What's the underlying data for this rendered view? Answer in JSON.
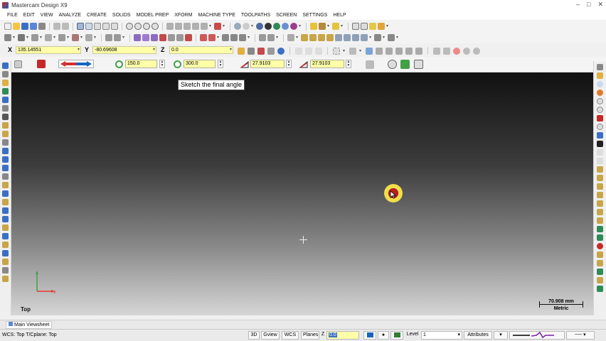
{
  "app": {
    "title": "Mastercam Design X9"
  },
  "menu": [
    "FILE",
    "EDIT",
    "VIEW",
    "ANALYZE",
    "CREATE",
    "SOLIDS",
    "MODEL PREP",
    "XFORM",
    "MACHINE TYPE",
    "TOOLPATHS",
    "SCREEN",
    "SETTINGS",
    "HELP"
  ],
  "coords": {
    "x_label": "X",
    "x_value": "135.14551",
    "y_label": "Y",
    "y_value": "-80.69608",
    "z_label": "Z",
    "z_value": "0.0"
  },
  "ribbon": {
    "field1": "150.0",
    "field2": "300.0",
    "field3": "27.9103",
    "field4": "27.9103"
  },
  "graphics": {
    "prompt": "Sketch the final angle",
    "view_name": "Top",
    "scale_value": "70.908 mm",
    "scale_unit": "Metric"
  },
  "viewsheet": {
    "tab": "Main Viewsheet"
  },
  "status": {
    "wcs_text": "WCS: Top  T/Cplane: Top",
    "btn_3d": "3D",
    "btn_gview": "Gview",
    "btn_wcs": "WCS",
    "btn_planes": "Planes",
    "z_label": "Z",
    "z_value": "0.0",
    "level_label": "Level",
    "level_value": "1",
    "attributes_label": "Attributes"
  },
  "colors": {
    "accent_yellow": "#ffffa8",
    "cursor_red": "#b32121",
    "cursor_yellow": "#f1df4a",
    "axis_x": "#e53935",
    "axis_y": "#43a047"
  }
}
